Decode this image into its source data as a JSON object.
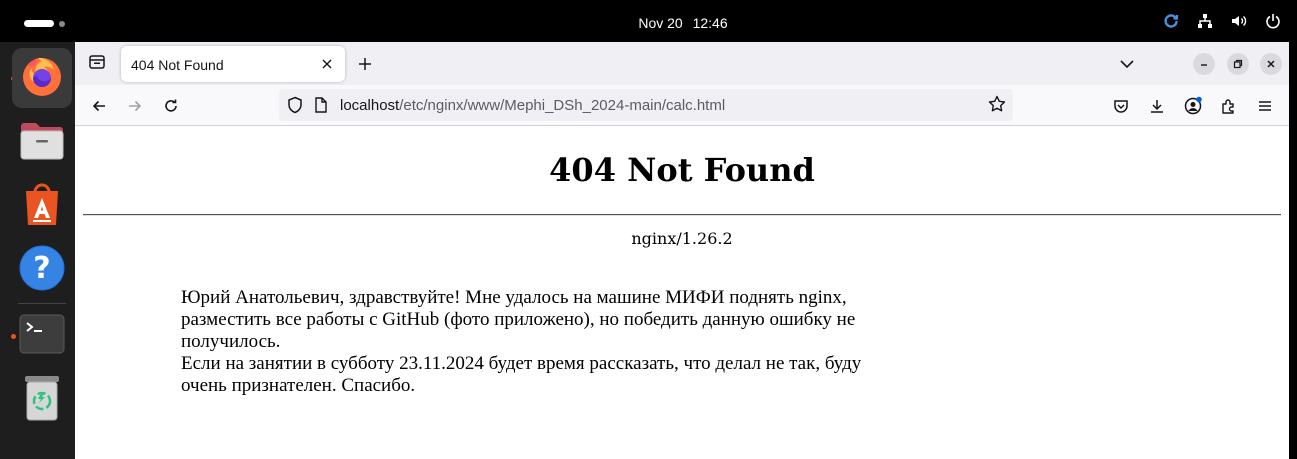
{
  "topbar": {
    "date": "Nov 20",
    "time": "12:46"
  },
  "dock": {
    "apps": [
      "firefox-icon",
      "files-icon",
      "app-center-icon",
      "help-icon",
      "terminal-icon",
      "trash-icon"
    ]
  },
  "browser": {
    "tab_title": "404 Not Found",
    "url_host": "localhost",
    "url_path": "/etc/nginx/www/Mephi_DSh_2024-main/calc.html"
  },
  "page": {
    "heading": "404 Not Found",
    "server": "nginx/1.26.2",
    "message_paragraph_1": "Юрий Анатольевич, здравствуйте! Мне удалось на машине МИФИ поднять nginx, разместить все работы с GitHub (фото приложено), но победить данную ошибку не получилось.",
    "message_paragraph_2": "Если на занятии в субботу 23.11.2024 будет время рассказать, что делал не так, буду очень признателен. Спасибо."
  },
  "colors": {
    "accent_orange": "#e95420",
    "firefox_blue": "#0060df"
  }
}
